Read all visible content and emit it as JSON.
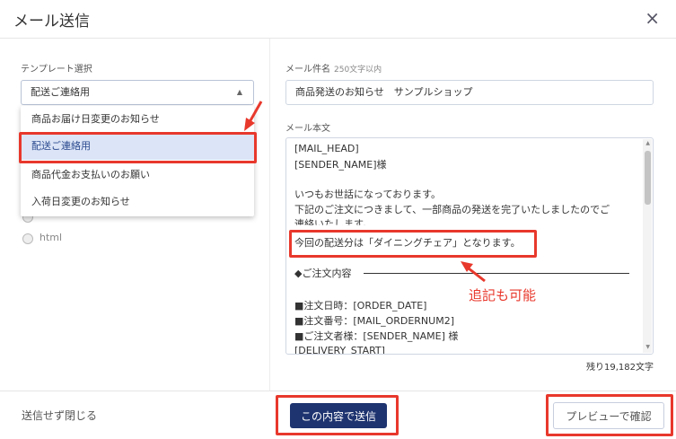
{
  "dialog": {
    "title": "メール送信",
    "close_glyph": "×"
  },
  "template": {
    "label": "テンプレート選択",
    "selected": "配送ご連絡用",
    "caret_glyph": "▲",
    "options": [
      {
        "label": "商品お届け日変更のお知らせ"
      },
      {
        "label": "配送ご連絡用",
        "selected": true
      },
      {
        "label": "商品代金お支払いのお願い"
      },
      {
        "label": "入荷日変更のお知らせ"
      }
    ]
  },
  "format": {
    "options": [
      {
        "label": ""
      },
      {
        "label": "html"
      }
    ]
  },
  "subject": {
    "label": "メール件名",
    "hint": "250文字以内",
    "value": "商品発送のお知らせ　サンプルショップ"
  },
  "body": {
    "label": "メール本文",
    "lines": [
      "[MAIL_HEAD]",
      "[SENDER_NAME]様",
      "",
      "いつもお世話になっております。",
      "下記のご注文につきまして、一部商品の発送を完了いたしましたのでご",
      "連絡いたします。",
      "今回の配送分は「ダイニングチェア」となります。",
      "",
      "◆ご注文内容",
      "",
      "■注文日時：[ORDER_DATE]",
      "■注文番号：[MAIL_ORDERNUM2]",
      "■ご注文者様：[SENDER_NAME] 様",
      "[DELIVERY_START]"
    ],
    "remaining": "残り19,182文字"
  },
  "annotation": {
    "text": "追記も可能",
    "color": "#e8382c"
  },
  "footer": {
    "close_label": "送信せず閉じる",
    "send_label": "この内容で送信",
    "preview_label": "プレビューで確認"
  },
  "colors": {
    "primary": "#1e3470",
    "highlight": "#e8382c",
    "selected_option_bg": "#dce5f7"
  }
}
